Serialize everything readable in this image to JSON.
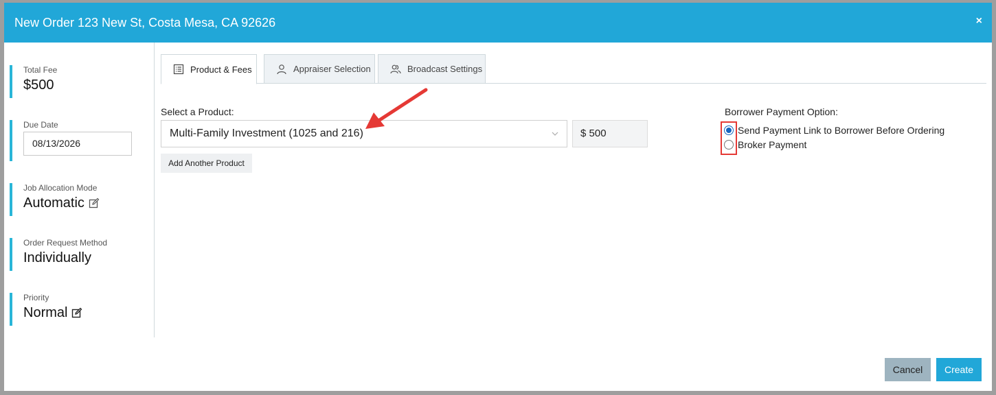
{
  "header": {
    "title": "New Order 123 New St, Costa Mesa, CA 92626",
    "close_symbol": "×"
  },
  "sidebar": {
    "total_fee": {
      "label": "Total Fee",
      "value": "$500"
    },
    "due_date": {
      "label": "Due Date",
      "value": "08/13/2026"
    },
    "job_allocation": {
      "label": "Job Allocation Mode",
      "value": "Automatic"
    },
    "order_request": {
      "label": "Order Request Method",
      "value": "Individually"
    },
    "priority": {
      "label": "Priority",
      "value": "Normal"
    }
  },
  "tabs": [
    {
      "label": "Product & Fees",
      "icon": "list-icon",
      "active": true
    },
    {
      "label": "Appraiser Selection",
      "icon": "user-icon",
      "active": false
    },
    {
      "label": "Broadcast Settings",
      "icon": "users-icon",
      "active": false
    }
  ],
  "product": {
    "select_label": "Select a Product:",
    "selected": "Multi-Family Investment (1025 and 216)",
    "price": "$ 500",
    "add_button": "Add Another Product"
  },
  "payment": {
    "label": "Borrower Payment Option:",
    "options": [
      {
        "label": "Send Payment Link to Borrower Before Ordering",
        "checked": true
      },
      {
        "label": "Broker Payment",
        "checked": false
      }
    ]
  },
  "footer": {
    "cancel": "Cancel",
    "create": "Create"
  },
  "colors": {
    "header": "#21a7d8",
    "accent": "#29b6d8",
    "annotation": "#e53935"
  }
}
